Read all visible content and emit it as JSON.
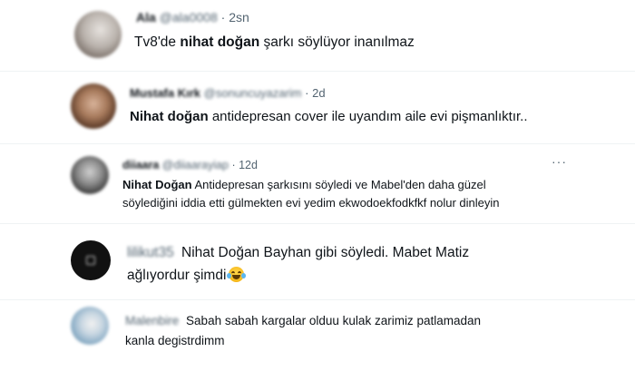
{
  "tweets": [
    {
      "name": "Ala",
      "handle": "@ala0008",
      "dot": "·",
      "time": "2sn",
      "line1_pre": "Tv8'de ",
      "line1_bold": "nihat doğan",
      "line1_post": " şarkı söylüyor inanılmaz"
    },
    {
      "name": "Mustafa Kırk",
      "handle": "@sonuncuyazarim",
      "dot": "·",
      "time": "2d",
      "line1_bold": "Nihat doğan",
      "line1_post": " antidepresan cover ile uyandım aile evi pişmanlıktır.."
    },
    {
      "name": "diiaara",
      "handle": "@diiaarayiap",
      "dot": "·",
      "time": "12d",
      "more": "···",
      "line1_bold": "Nihat Doğan",
      "line1_post": " Antidepresan şarkısını söyledi ve Mabel'den daha güzel",
      "line2": "söylediğini iddia etti gülmekten evi yedim ekwodoekfodkfkf nolur dinleyin"
    },
    {
      "name": "lilikut35",
      "line1": "Nihat Doğan Bayhan gibi söyledi. Mabet Matiz",
      "line2": "ağlıyordur şimdi",
      "emoji": "face-with-tears-of-joy"
    },
    {
      "name": "Malenbire",
      "line1": "Sabah sabah kargalar olduu kulak zarimiz patlamadan",
      "line2": "kanla degistrdimm"
    }
  ]
}
